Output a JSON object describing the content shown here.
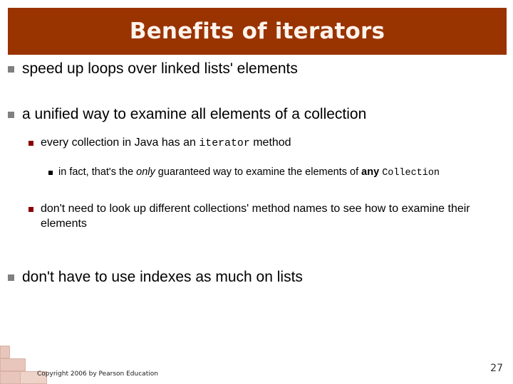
{
  "slide": {
    "title": "Benefits of iterators",
    "banner_color": "#993300",
    "title_color": "#FDF3EC",
    "background_color": "#FFFFFF"
  },
  "markers": {
    "level1_color": "#808080",
    "level2_color": "#8B0000",
    "level3_color": "#000000"
  },
  "outline": {
    "b1": {
      "text": "speed up loops over linked lists' elements"
    },
    "b2": {
      "text": "a unified way to examine all elements of a collection"
    },
    "b2_s1": {
      "part1": "every collection in Java has an ",
      "code1": "iterator",
      "part2": " method"
    },
    "b2_s1_s1": {
      "part1": "in fact, that's the ",
      "italic1": "only",
      "part2": " guaranteed way to examine the elements of ",
      "bold1": "any",
      "part3": " ",
      "code1": "Collection"
    },
    "b2_s2": {
      "text": "don't need to look up different collections' method names to see how to examine their elements"
    },
    "b3": {
      "text": "don't have to use indexes as much on lists"
    }
  },
  "footer": {
    "copyright": "Copyright 2006 by Pearson Education",
    "page_number": "27"
  }
}
